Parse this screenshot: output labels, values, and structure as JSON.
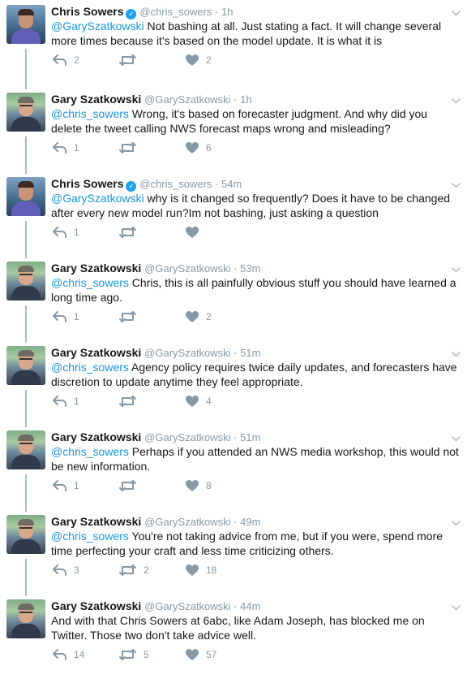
{
  "tweets": [
    {
      "name": "Chris Sowers",
      "verified": true,
      "handle": "@chris_sowers",
      "time": "1h",
      "mention": "@GarySzatkowski",
      "text": " Not bashing at all. Just stating a fact. It will change several more times because it's based on the model update. It is what it is",
      "replies": "2",
      "retweets": "",
      "likes": "2"
    },
    {
      "name": "Gary Szatkowski",
      "verified": false,
      "handle": "@GarySzatkowski",
      "time": "1h",
      "mention": "@chris_sowers",
      "text": " Wrong, it's based on forecaster judgment. And why did you delete the tweet calling NWS forecast maps wrong and misleading?",
      "replies": "1",
      "retweets": "",
      "likes": "6"
    },
    {
      "name": "Chris Sowers",
      "verified": true,
      "handle": "@chris_sowers",
      "time": "54m",
      "mention": "@GarySzatkowski",
      "text": " why is it changed so frequently? Does it have to be changed after every new model run?Im not bashing, just asking a question",
      "replies": "1",
      "retweets": "",
      "likes": ""
    },
    {
      "name": "Gary Szatkowski",
      "verified": false,
      "handle": "@GarySzatkowski",
      "time": "53m",
      "mention": "@chris_sowers",
      "text": " Chris, this is all painfully obvious stuff you should have learned a long time ago.",
      "replies": "1",
      "retweets": "",
      "likes": "2"
    },
    {
      "name": "Gary Szatkowski",
      "verified": false,
      "handle": "@GarySzatkowski",
      "time": "51m",
      "mention": "@chris_sowers",
      "text": " Agency policy requires twice daily updates, and forecasters have discretion to update anytime they feel appropriate.",
      "replies": "1",
      "retweets": "",
      "likes": "4"
    },
    {
      "name": "Gary Szatkowski",
      "verified": false,
      "handle": "@GarySzatkowski",
      "time": "51m",
      "mention": "@chris_sowers",
      "text": " Perhaps if you attended an NWS media workshop, this would not be new information.",
      "replies": "1",
      "retweets": "",
      "likes": "8"
    },
    {
      "name": "Gary Szatkowski",
      "verified": false,
      "handle": "@GarySzatkowski",
      "time": "49m",
      "mention": "@chris_sowers",
      "text": " You're not taking advice from me, but if you were, spend more time perfecting your craft and less time criticizing others.",
      "replies": "3",
      "retweets": "2",
      "likes": "18"
    },
    {
      "name": "Gary Szatkowski",
      "verified": false,
      "handle": "@GarySzatkowski",
      "time": "44m",
      "mention": "",
      "text": "And with that Chris Sowers at 6abc, like Adam Joseph, has blocked me on Twitter.  Those two don't take advice well.",
      "replies": "14",
      "retweets": "5",
      "likes": "57"
    }
  ],
  "icons": {
    "reply": "reply-icon",
    "retweet": "retweet-icon",
    "like": "heart-icon",
    "caret": "chevron-down-icon",
    "verified": "verified-badge-icon"
  },
  "colors": {
    "link": "#1b95e0",
    "muted": "#8899a6",
    "verified": "#1da1f2",
    "thread_line": "#9fc1dc"
  }
}
